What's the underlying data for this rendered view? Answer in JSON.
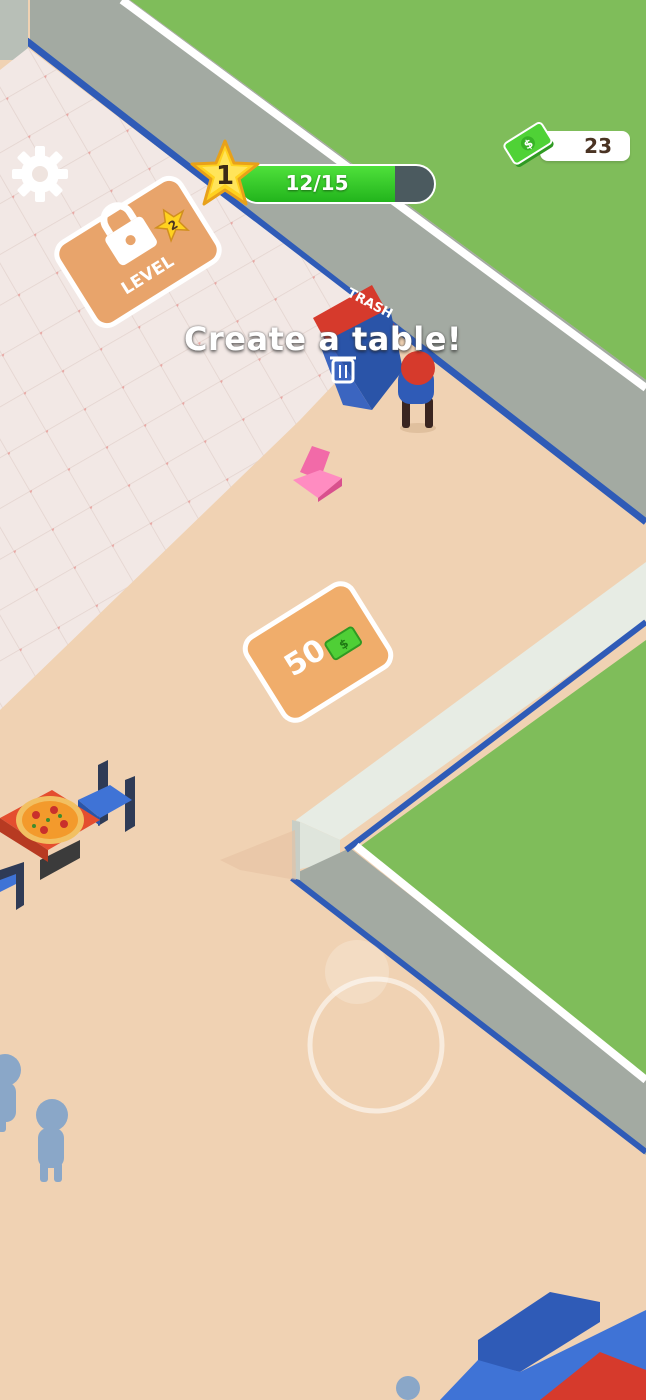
{
  "hud": {
    "settings_icon": "gear-icon",
    "level": "1",
    "xp_progress": "12/15",
    "xp_fraction": 0.8,
    "money": "23",
    "money_icon": "cash-icon"
  },
  "objective": {
    "text": "Create a table!"
  },
  "world": {
    "locked_area": {
      "label": "LEVEL",
      "required_level": "2",
      "icon": "lock-icon"
    },
    "trash_bin": {
      "label": "TRASH",
      "icon": "trash-can-icon"
    },
    "table_build_spot": {
      "cost": "50",
      "icon": "cash-icon"
    }
  },
  "colors": {
    "grass": "#7fbd5a",
    "floor": "#f0d2b3",
    "wall": "#a3aaa2",
    "wall_trim": "#2f5bb7",
    "tile_floor": "#f2e8e5",
    "pad": "#f0ad6b",
    "xp_fill": "#34c52a",
    "star": "#ffd21f"
  }
}
